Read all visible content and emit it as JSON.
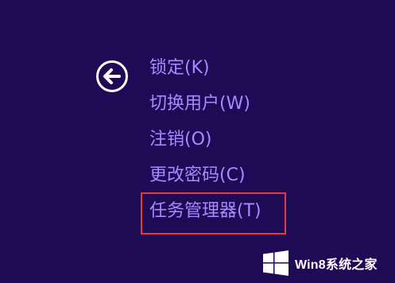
{
  "window": {
    "background_color": "#1e0a55",
    "text_color": "#a889ff",
    "highlight_color": "#e33b3b"
  },
  "back_button": {
    "icon": "back-arrow-circle-icon"
  },
  "menu": {
    "items": [
      {
        "label": "锁定(K)"
      },
      {
        "label": "切换用户(W)"
      },
      {
        "label": "注销(O)"
      },
      {
        "label": "更改密码(C)"
      },
      {
        "label": "任务管理器(T)",
        "highlighted": true
      }
    ]
  },
  "watermark": {
    "icon": "windows-logo-icon",
    "text": "Win8系统之家"
  }
}
